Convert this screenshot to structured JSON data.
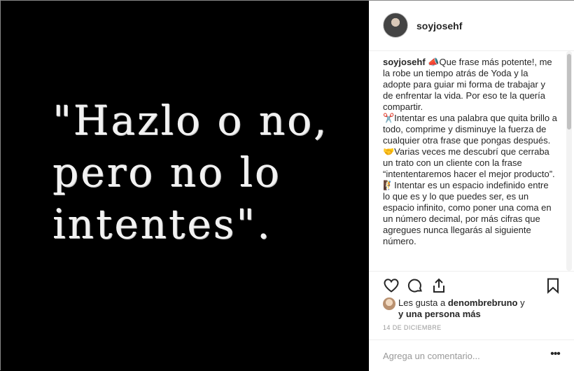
{
  "post": {
    "image_quote_lines": [
      "\"Hazlo o no,",
      "pero no lo",
      "intentes\"."
    ]
  },
  "header": {
    "username": "soyjosehf"
  },
  "caption": {
    "username": "soyjosehf",
    "paragraphs": [
      "📣Que frase más potente!, me la robe un tiempo atrás de Yoda y la adopte para guiar mi forma de trabajar y de enfrentar la vida. Por eso te la quería compartir.",
      "✂️Intentar es una palabra que quita brillo a todo, comprime y disminuye la fuerza de cualquier otra frase que pongas después.",
      "🤝Varias veces me descubrí que cerraba un trato con un cliente con la frase “intententaremos hacer el mejor producto”.",
      "🧗Intentar es un espacio indefinido entre lo que es y lo que puedes ser, es un espacio infinito, como poner una coma en un número decimal, por más cifras que agregues nunca llegarás al siguiente número."
    ]
  },
  "actions": {
    "icons": [
      "heart-icon",
      "comment-icon",
      "share-icon",
      "bookmark-icon"
    ]
  },
  "likes": {
    "prefix": "Les gusta a ",
    "user": "denombrebruno",
    "middle": " y",
    "others": "y una persona más"
  },
  "date": "14 DE DICIEMBRE",
  "comment": {
    "placeholder": "Agrega un comentario...",
    "more_label": "•••"
  }
}
